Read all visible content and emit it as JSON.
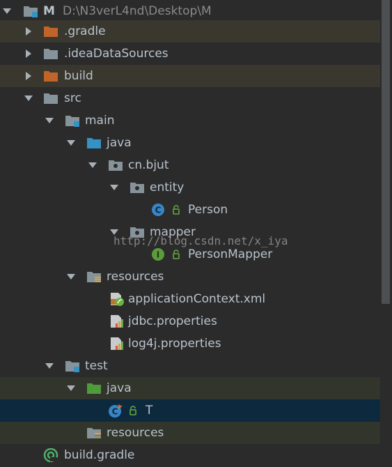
{
  "project": {
    "root_name": "M",
    "root_path": "D:\\N3verL4nd\\Desktop\\M"
  },
  "tree": {
    "gradle_dir": ".gradle",
    "idea_dir": ".ideaDataSources",
    "build_dir": "build",
    "src": "src",
    "main": "main",
    "main_java": "java",
    "package": "cn.bjut",
    "entity": "entity",
    "person": "Person",
    "mapper": "mapper",
    "person_mapper": "PersonMapper",
    "main_resources": "resources",
    "app_context": "applicationContext.xml",
    "jdbc": "jdbc.properties",
    "log4j": "log4j.properties",
    "test": "test",
    "test_java": "java",
    "test_class": "T",
    "test_resources": "resources",
    "build_gradle": "build.gradle"
  },
  "watermark": "http://blog.csdn.net/x_iya",
  "colors": {
    "background": "#2b2b2b",
    "selection": "#0d293e",
    "folder_gray": "#87939a",
    "folder_orange": "#c0642a",
    "source_blue": "#3592c4",
    "test_green": "#4e9a3c",
    "class_blue": "#3a84c5",
    "interface_green": "#5c9b3c"
  },
  "icons": {
    "expanded": "chevron-down-icon",
    "collapsed": "chevron-right-icon",
    "folder": "folder-icon",
    "package": "package-icon",
    "class": "class-icon",
    "interface": "interface-icon",
    "properties": "properties-file-icon",
    "xml": "spring-xml-icon",
    "gradle": "gradle-icon"
  }
}
